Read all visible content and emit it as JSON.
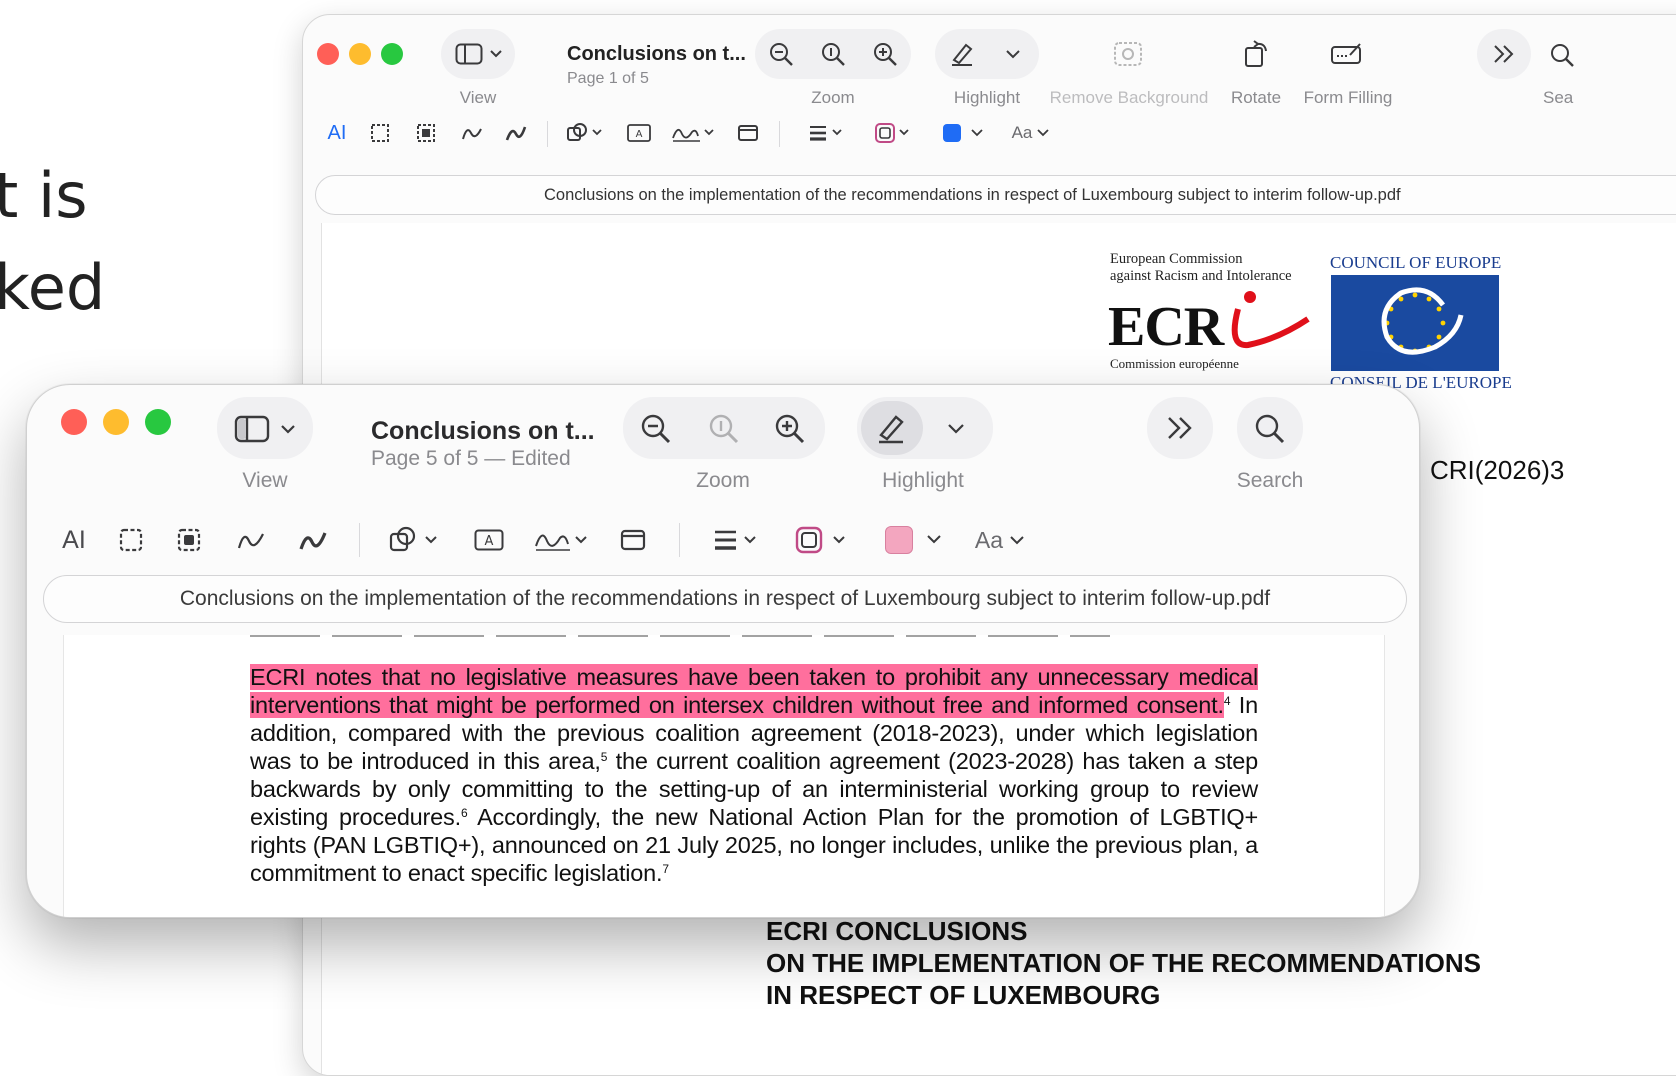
{
  "background_text": [
    "t is",
    "ked"
  ],
  "back_window": {
    "title": "Conclusions on t...",
    "subtitle": "Page 1 of 5",
    "toolbar": {
      "view_label": "View",
      "zoom_label": "Zoom",
      "highlight_label": "Highlight",
      "remove_bg_label": "Remove Background",
      "rotate_label": "Rotate",
      "form_label": "Form Filling",
      "search_label": "Sea",
      "text_style": "Aa"
    },
    "file_name": "Conclusions on the implementation of the recommendations in respect of Luxembourg subject to interim follow-up.pdf",
    "document": {
      "ecri_caption_1": "European Commission",
      "ecri_caption_2": "against Racism and Intolerance",
      "ecri_logo": "ECR",
      "ecri_caption_3": "Commission européenne",
      "coe_top": "COUNCIL OF EUROPE",
      "coe_bottom": "CONSEIL DE L'EUROPE",
      "code": "CRI(2026)3",
      "heading_1": "ECRI CONCLUSIONS",
      "heading_2": "ON THE IMPLEMENTATION OF THE RECOMMENDATIONS",
      "heading_3": "IN RESPECT OF LUXEMBOURG"
    },
    "colors": {
      "shape_color": "#1f6cf5"
    }
  },
  "front_window": {
    "title": "Conclusions on t...",
    "subtitle": "Page 5 of 5 — Edited",
    "toolbar": {
      "view_label": "View",
      "zoom_label": "Zoom",
      "highlight_label": "Highlight",
      "search_label": "Search",
      "text_style": "Aa"
    },
    "file_name": "Conclusions on the implementation of the recommendations in respect of Luxembourg subject to interim follow-up.pdf",
    "document": {
      "highlighted_text": "ECRI notes that no legislative measures have been taken to prohibit any unnecessary medical interventions that might be performed on intersex children without free and informed consent.",
      "fn4": "4",
      "part1": "In addition, compared with the previous coalition agreement (2018-2023), under which legislation was to be introduced in this area,",
      "fn5": "5",
      "part2": " the current coalition agreement (2023-2028) has taken a step backwards by only committing to the setting-up of an interministerial working group to review existing procedures.",
      "fn6": "6",
      "part3": " Accordingly, the new National Action Plan for the promotion of LGBTIQ+ rights (PAN LGBTIQ+), announced on 21 July 2025, no longer includes, unlike the previous plan, a commitment to enact specific legislation.",
      "fn7": "7"
    },
    "colors": {
      "highlight": "#ff6f9d",
      "shape_color": "#f3a6bf"
    }
  },
  "traffic_lights": {
    "close": "#ff5f57",
    "minimize": "#febc2e",
    "zoom": "#28c840"
  }
}
